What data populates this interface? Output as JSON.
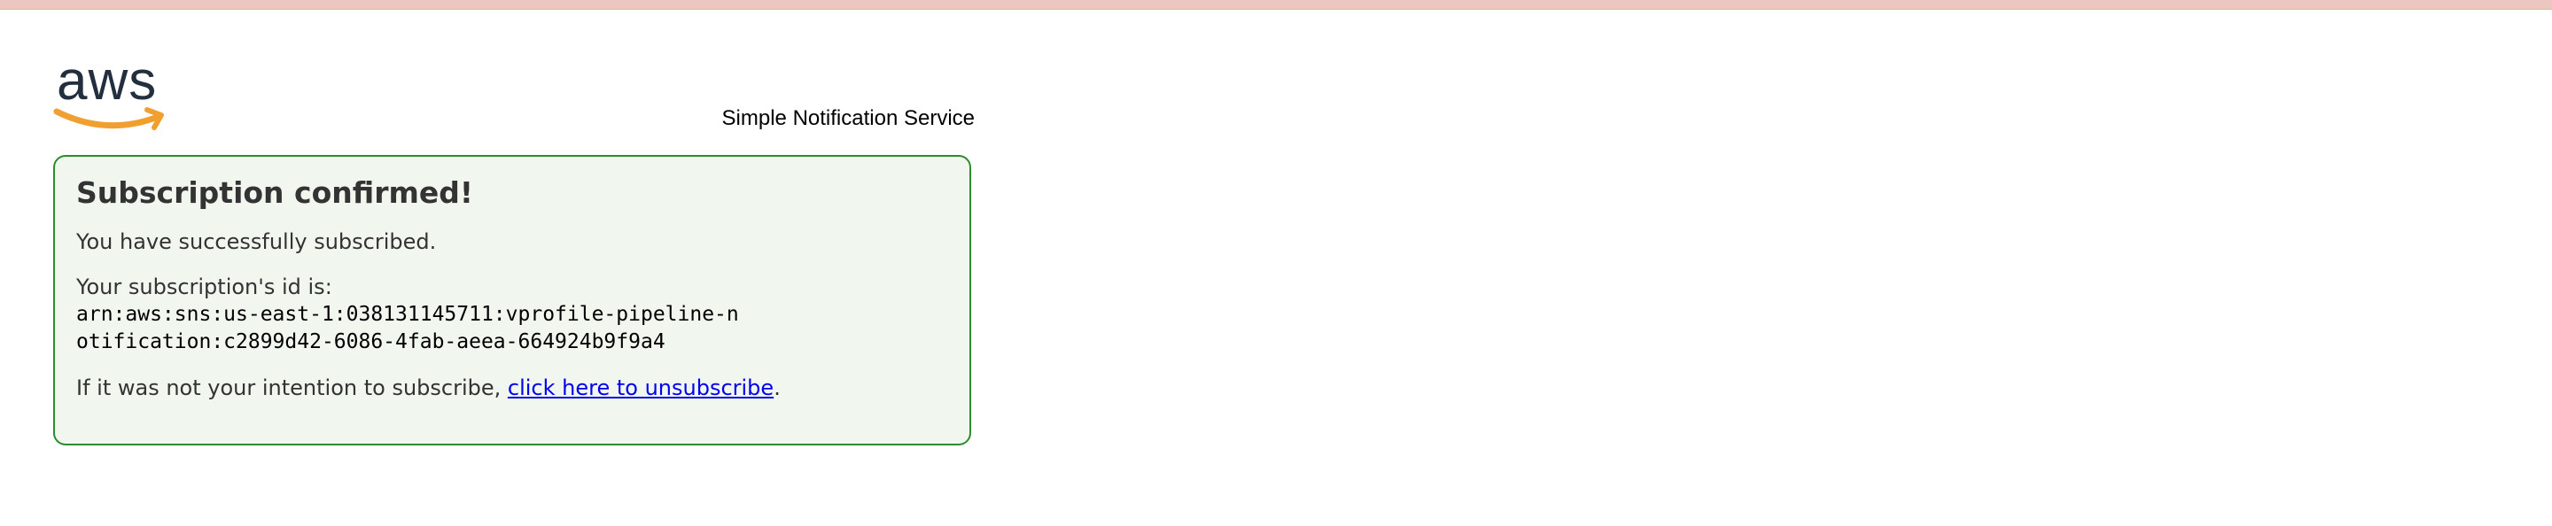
{
  "brand": {
    "logo_text": "aws",
    "service_name": "Simple Notification Service",
    "logo_text_color": "#232f3e",
    "smile_color": "#f0a030"
  },
  "panel": {
    "title": "Subscription confirmed!",
    "success_message": "You have successfully subscribed.",
    "subscription_id_label": "Your subscription's id is:",
    "subscription_id": "arn:aws:sns:us-east-1:038131145711:vprofile-pipeline-notification:c2899d42-6086-4fab-aeea-664924b9f9a4",
    "unsubscribe_prefix": "If it was not your intention to subscribe, ",
    "unsubscribe_link_text": "click here to unsubscribe",
    "unsubscribe_suffix": ".",
    "border_color": "#2e8b2e",
    "background_color": "#f1f6ef"
  }
}
